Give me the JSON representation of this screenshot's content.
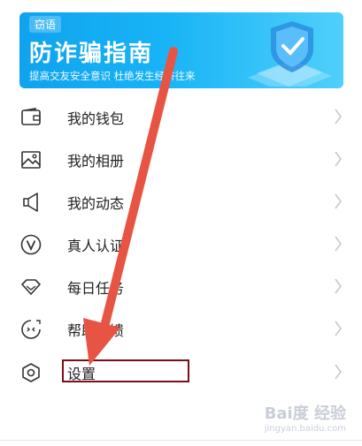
{
  "banner": {
    "tag": "窃语",
    "title": "防诈骗指南",
    "subtitle": "提高交友安全意识 杜绝发生经济往来"
  },
  "menu": [
    {
      "label": "我的钱包",
      "icon": "wallet-icon"
    },
    {
      "label": "我的相册",
      "icon": "photo-album-icon"
    },
    {
      "label": "我的动态",
      "icon": "megaphone-icon"
    },
    {
      "label": "真人认证",
      "icon": "verify-v-icon"
    },
    {
      "label": "每日任务",
      "icon": "diamond-icon"
    },
    {
      "label": "帮助反馈",
      "icon": "feedback-face-icon"
    },
    {
      "label": "设置",
      "icon": "settings-hexagon-icon"
    }
  ],
  "annotation": {
    "arrow_color": "#e85444",
    "box_color": "#7a0f1a"
  },
  "watermark": {
    "brand": "Bai度 经验",
    "url": "jingyan.baidu.com"
  },
  "colors": {
    "banner_start": "#0fa3ee",
    "banner_end": "#4fd0fb",
    "icon_color": "#333333",
    "chevron_color": "#c8c8c8"
  }
}
